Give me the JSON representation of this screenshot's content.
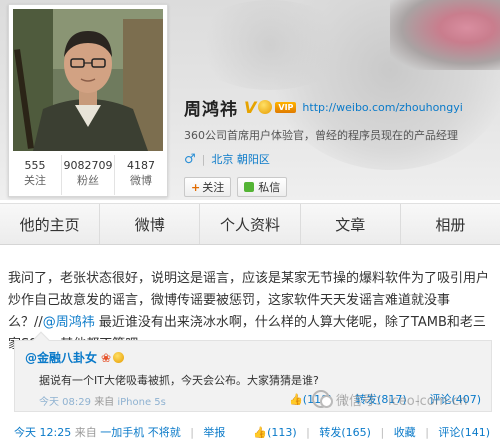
{
  "profile": {
    "name": "周鸿祎",
    "verified_mark": "V",
    "vip_label": "VIP",
    "homepage_url": "http://weibo.com/zhouhongyi",
    "bio": "360公司首席用户体验官，曾经的程序员现在的产品经理",
    "gender_symbol": "♂",
    "location": "北京 朝阳区",
    "follow_button": "关注",
    "message_button": "私信",
    "stats": [
      {
        "value": "555",
        "label": "关注"
      },
      {
        "value": "9082709",
        "label": "粉丝"
      },
      {
        "value": "4187",
        "label": "微博"
      }
    ]
  },
  "tabs": [
    {
      "label": "他的主页"
    },
    {
      "label": "微博"
    },
    {
      "label": "个人资料"
    },
    {
      "label": "文章"
    },
    {
      "label": "相册"
    }
  ],
  "post": {
    "text_before_mention": "我问了，老张状态很好，说明这是谣言，应该是某家无节操的爆料软件为了吸引用户炒作自己故意发的谣言，微博传谣要被惩罚，这家软件天天发谣言难道就没事么？//",
    "mention": "@周鸿祎",
    "text_after_mention": " 最近谁没有出来浇冰水啊，什么样的人算大佬呢，除了TAMB和老三家SSN，其他都不算吧",
    "time": "今天 12:25",
    "source_prefix": "来自",
    "source": "一加手机 不将就",
    "report": "举报",
    "like_count": "(113)",
    "repost": "转发(165)",
    "favorite": "收藏",
    "comment": "评论(141)"
  },
  "quoted": {
    "author": "@金融八卦女",
    "text": "据说有一个IT大佬吸毒被抓，今天会公布。大家猜猜是谁?",
    "time": "今天 08:29",
    "source_prefix": "来自",
    "source": "iPhone 5s",
    "like_count": "(118)",
    "repost": "转发(817)",
    "comment": "评论(407)"
  },
  "watermark": "微信号：iceo-com-cn",
  "colors": {
    "link": "#0a7ac9",
    "verified": "#e6a300",
    "accent_orange": "#e26b00"
  }
}
